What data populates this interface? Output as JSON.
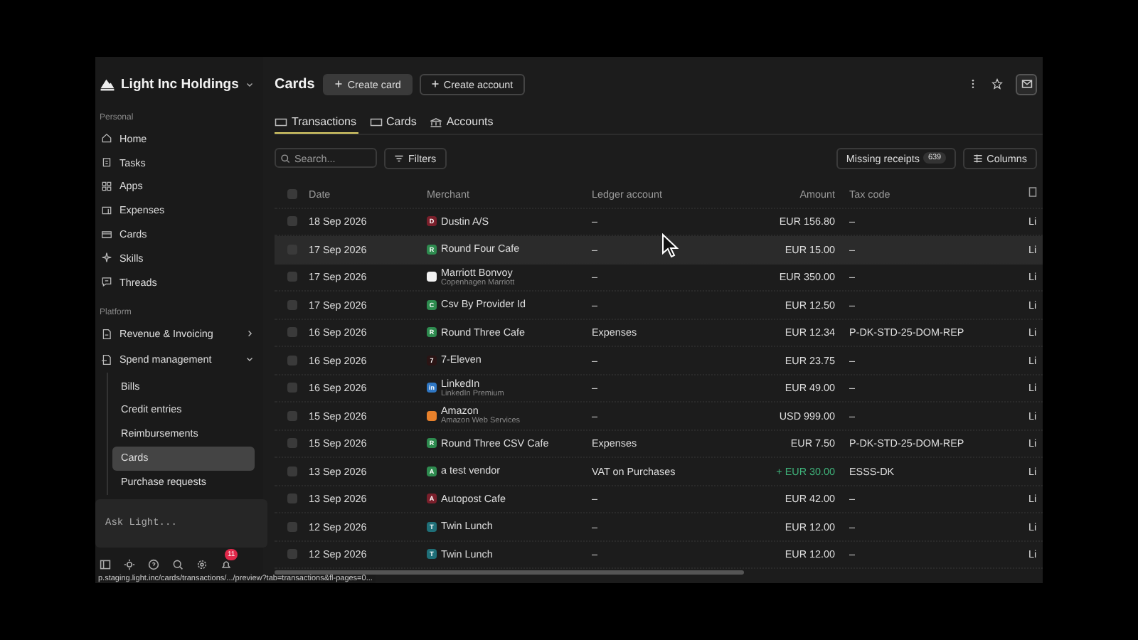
{
  "workspace": {
    "name": "Light Inc Holdings"
  },
  "sidebar": {
    "personal_heading": "Personal",
    "personal_items": [
      {
        "label": "Home",
        "selected": false
      },
      {
        "label": "Tasks",
        "selected": false
      },
      {
        "label": "Apps",
        "selected": false
      },
      {
        "label": "Expenses",
        "selected": false
      },
      {
        "label": "Cards",
        "selected": false
      },
      {
        "label": "Skills",
        "selected": false
      },
      {
        "label": "Threads",
        "selected": false
      }
    ],
    "platform_heading": "Platform",
    "platform_items": [
      {
        "label": "Revenue & Invoicing",
        "expanded": false
      },
      {
        "label": "Spend management",
        "expanded": true,
        "children": [
          {
            "label": "Bills",
            "selected": false
          },
          {
            "label": "Credit entries",
            "selected": false
          },
          {
            "label": "Reimbursements",
            "selected": false
          },
          {
            "label": "Cards",
            "selected": true
          },
          {
            "label": "Purchase requests",
            "selected": false
          }
        ]
      }
    ]
  },
  "ask": {
    "placeholder": "Ask Light..."
  },
  "notifications": {
    "count": "11"
  },
  "status_url": "p.staging.light.inc/cards/transactions/.../preview?tab=transactions&fl-pages=0...",
  "page": {
    "title": "Cards",
    "buttons": [
      {
        "label": "Create card",
        "kind": "primary"
      },
      {
        "label": "Create account",
        "kind": "secondary"
      }
    ]
  },
  "tabs": [
    {
      "label": "Transactions",
      "selected": true
    },
    {
      "label": "Cards",
      "selected": false
    },
    {
      "label": "Accounts",
      "selected": false
    }
  ],
  "toolbar": {
    "search_placeholder": "Search...",
    "filters": "Filters",
    "missing_receipts": "Missing receipts",
    "missing_count": "639",
    "columns": "Columns"
  },
  "table": {
    "all_selected": false,
    "columns": [
      "Date",
      "Merchant",
      "Ledger account",
      "Amount",
      "Tax code"
    ],
    "rows": [
      {
        "selected": false,
        "date": "18 Sep 2026",
        "logo": "D",
        "color": "#7a1f2b",
        "merchant": "Dustin A/S",
        "ledger": "–",
        "amount": "EUR 156.80",
        "credit": false,
        "tax": "–",
        "column_6": "Li",
        "highlighted": false
      },
      {
        "selected": false,
        "date": "17 Sep 2026",
        "logo": "R",
        "color": "#2e8b4f",
        "merchant": "Round Four Cafe",
        "ledger": "–",
        "amount": "EUR 15.00",
        "credit": false,
        "tax": "–",
        "column_6": "Li",
        "highlighted": true
      },
      {
        "selected": false,
        "date": "17 Sep 2026",
        "logo": "",
        "color": "#f2f2f2",
        "merchant": "Marriott Bonvoy",
        "sub": "Copenhagen Marriott",
        "ledger": "–",
        "amount": "EUR 350.00",
        "credit": false,
        "tax": "–",
        "column_6": "Li",
        "highlighted": false
      },
      {
        "selected": false,
        "date": "17 Sep 2026",
        "logo": "C",
        "color": "#2e8b4f",
        "merchant": "Csv By Provider Id",
        "ledger": "–",
        "amount": "EUR 12.50",
        "credit": false,
        "tax": "–",
        "column_6": "Li",
        "highlighted": false
      },
      {
        "selected": false,
        "date": "16 Sep 2026",
        "logo": "R",
        "color": "#2e8b4f",
        "merchant": "Round Three Cafe",
        "ledger": "Expenses",
        "amount": "EUR 12.34",
        "credit": false,
        "tax": "P-DK-STD-25-DOM-REP",
        "column_6": "Li",
        "highlighted": false
      },
      {
        "selected": false,
        "date": "16 Sep 2026",
        "logo": "7",
        "color": "#2a1414",
        "merchant": "7-Eleven",
        "ledger": "–",
        "amount": "EUR 23.75",
        "credit": false,
        "tax": "–",
        "column_6": "Li",
        "highlighted": false
      },
      {
        "selected": false,
        "date": "16 Sep 2026",
        "logo": "in",
        "color": "#2f77c4",
        "merchant": "LinkedIn",
        "sub": "LinkedIn Premium",
        "ledger": "–",
        "amount": "EUR 49.00",
        "credit": false,
        "tax": "–",
        "column_6": "Li",
        "highlighted": false
      },
      {
        "selected": false,
        "date": "15 Sep 2026",
        "logo": "",
        "color": "#e8812b",
        "merchant": "Amazon",
        "sub": "Amazon Web Services",
        "ledger": "–",
        "amount": "USD 999.00",
        "credit": false,
        "tax": "–",
        "column_6": "Li",
        "highlighted": false
      },
      {
        "selected": false,
        "date": "15 Sep 2026",
        "logo": "R",
        "color": "#2e8b4f",
        "merchant": "Round Three CSV Cafe",
        "ledger": "Expenses",
        "amount": "EUR 7.50",
        "credit": false,
        "tax": "P-DK-STD-25-DOM-REP",
        "column_6": "Li",
        "highlighted": false
      },
      {
        "selected": false,
        "date": "13 Sep 2026",
        "logo": "A",
        "color": "#2e8b4f",
        "merchant": "a test vendor",
        "ledger": "VAT on Purchases",
        "amount": "+ EUR 30.00",
        "credit": true,
        "tax": "ESSS-DK",
        "column_6": "Li",
        "highlighted": false
      },
      {
        "selected": false,
        "date": "13 Sep 2026",
        "logo": "A",
        "color": "#7a1f2b",
        "merchant": "Autopost Cafe",
        "ledger": "–",
        "amount": "EUR 42.00",
        "credit": false,
        "tax": "–",
        "column_6": "Li",
        "highlighted": false
      },
      {
        "selected": false,
        "date": "12 Sep 2026",
        "logo": "T",
        "color": "#1f6f78",
        "merchant": "Twin Lunch",
        "ledger": "–",
        "amount": "EUR 12.00",
        "credit": false,
        "tax": "–",
        "column_6": "Li",
        "highlighted": false
      },
      {
        "selected": false,
        "date": "12 Sep 2026",
        "logo": "T",
        "color": "#1f6f78",
        "merchant": "Twin Lunch",
        "ledger": "–",
        "amount": "EUR 12.00",
        "credit": false,
        "tax": "–",
        "column_6": "Li",
        "highlighted": false
      }
    ]
  }
}
